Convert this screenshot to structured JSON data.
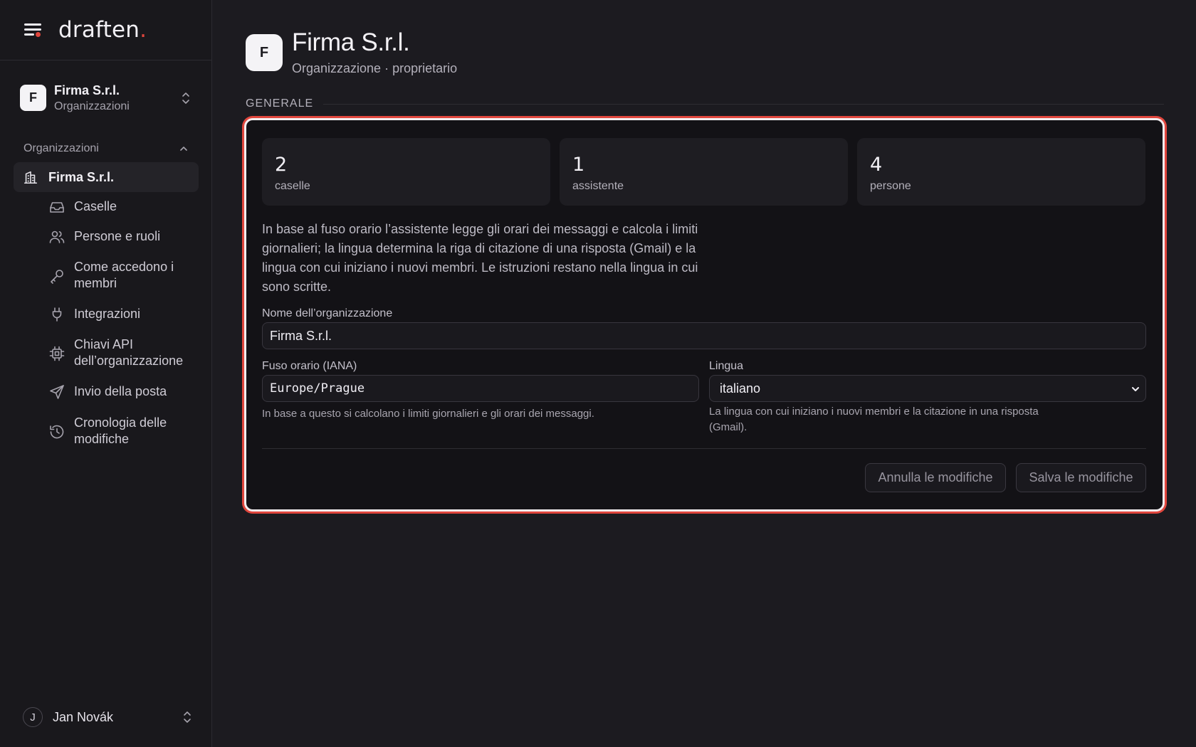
{
  "app": {
    "logo_text": "draften",
    "logo_dot": "."
  },
  "sidebar": {
    "org_switch": {
      "initial": "F",
      "name": "Firma S.r.l.",
      "sub": "Organizzazioni"
    },
    "section_title": "Organizzazioni",
    "active_item": "Firma S.r.l.",
    "items": [
      {
        "label": "Caselle",
        "icon": "inbox-icon"
      },
      {
        "label": "Persone e ruoli",
        "icon": "users-icon"
      },
      {
        "label": "Come accedono i membri",
        "icon": "key-icon"
      },
      {
        "label": "Integrazioni",
        "icon": "plug-icon"
      },
      {
        "label": "Chiavi API dell’organizzazione",
        "icon": "chip-icon"
      },
      {
        "label": "Invio della posta",
        "icon": "send-icon"
      },
      {
        "label": "Cronologia delle modifiche",
        "icon": "history-icon"
      }
    ],
    "user": {
      "initial": "J",
      "name": "Jan Novák"
    }
  },
  "header": {
    "initial": "F",
    "title": "Firma S.r.l.",
    "subtitle": "Organizzazione · proprietario"
  },
  "section": {
    "label": "GENERALE"
  },
  "stats": [
    {
      "value": "2",
      "caption": "caselle"
    },
    {
      "value": "1",
      "caption": "assistente"
    },
    {
      "value": "4",
      "caption": "persone"
    }
  ],
  "form": {
    "description": "In base al fuso orario l’assistente legge gli orari dei messaggi e calcola i limiti giornalieri; la lingua determina la riga di citazione di una risposta (Gmail) e la lingua con cui iniziano i nuovi membri. Le istruzioni restano nella lingua in cui sono scritte.",
    "org_name_label": "Nome dell’organizzazione",
    "org_name_value": "Firma S.r.l.",
    "timezone_label": "Fuso orario (IANA)",
    "timezone_value": "Europe/Prague",
    "timezone_hint": "In base a questo si calcolano i limiti giornalieri e gli orari dei messaggi.",
    "language_label": "Lingua",
    "language_value": "italiano",
    "language_hint": "La lingua con cui iniziano i nuovi membri e la citazione in una risposta (Gmail).",
    "cancel_label": "Annulla le modifiche",
    "save_label": "Salva le modifiche"
  },
  "colors": {
    "accent": "#e0463d",
    "background": "#1c1b20",
    "sidebar": "#19181c",
    "card": "#131216"
  }
}
